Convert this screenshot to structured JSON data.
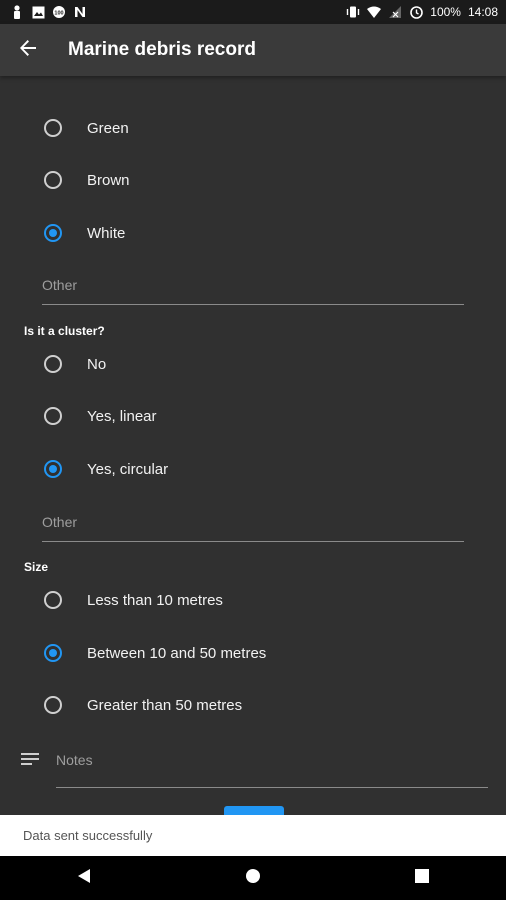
{
  "status_bar": {
    "battery": "100%",
    "time": "14:08",
    "icons_left": [
      "person-icon",
      "image-icon",
      "sync-badge-icon",
      "n-icon"
    ],
    "icons_right": [
      "vibrate-icon",
      "wifi-icon",
      "no-signal-icon",
      "alarm-icon",
      "battery-icon"
    ]
  },
  "app_bar": {
    "title": "Marine debris record",
    "back_icon": "arrow-back-icon"
  },
  "colour_options": {
    "options": [
      {
        "label": "Green",
        "checked": false
      },
      {
        "label": "Brown",
        "checked": false
      },
      {
        "label": "White",
        "checked": true
      }
    ],
    "other_placeholder": "Other"
  },
  "cluster": {
    "label": "Is it a cluster?",
    "options": [
      {
        "label": "No",
        "checked": false
      },
      {
        "label": "Yes, linear",
        "checked": false
      },
      {
        "label": "Yes, circular",
        "checked": true
      }
    ],
    "other_placeholder": "Other"
  },
  "size": {
    "label": "Size",
    "options": [
      {
        "label": "Less than 10 metres",
        "checked": false
      },
      {
        "label": "Between 10 and 50 metres",
        "checked": true
      },
      {
        "label": "Greater than 50 metres",
        "checked": false
      }
    ]
  },
  "notes": {
    "placeholder": "Notes",
    "icon": "notes-icon"
  },
  "snackbar": {
    "text": "Data sent successfully"
  },
  "colors": {
    "accent": "#2196f3",
    "background": "#303030",
    "app_bar": "#3a3a3a"
  }
}
